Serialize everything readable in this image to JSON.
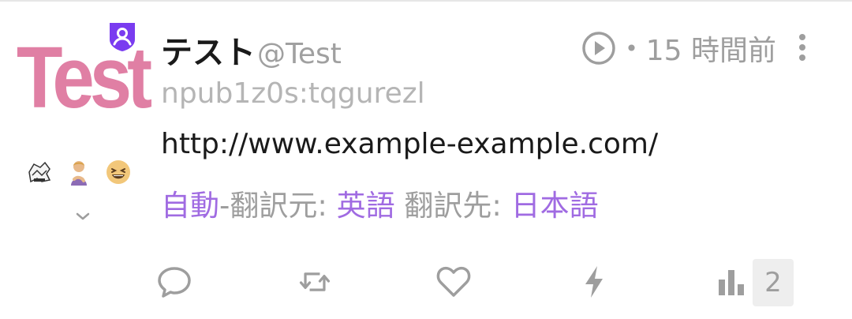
{
  "note": {
    "avatar_text": "Test",
    "display_name": "テスト",
    "handle": "@Test",
    "npub": "npub1z0s:tqgurezl",
    "time_ago": "15 時間前",
    "time_separator": "•",
    "content": "http://www.example-example.com/",
    "translation": {
      "auto": "自動",
      "from_label": "-翻訳元: ",
      "from_lang": "英語",
      "to_label": " 翻訳先: ",
      "to_lang": "日本語"
    },
    "stats_count": "2"
  },
  "icons": {
    "badge": "shield-user-icon",
    "play": "play-circle-icon",
    "more": "more-vertical-icon",
    "expand": "chevron-down-icon",
    "reply": "reply-icon",
    "repost": "repost-icon",
    "like": "heart-icon",
    "zap": "zap-icon",
    "stats": "bar-chart-icon"
  },
  "colors": {
    "accent": "#a06be2",
    "badge": "#7a3cf0",
    "avatar_text": "#e07fa4",
    "muted": "#9e9e9e"
  }
}
